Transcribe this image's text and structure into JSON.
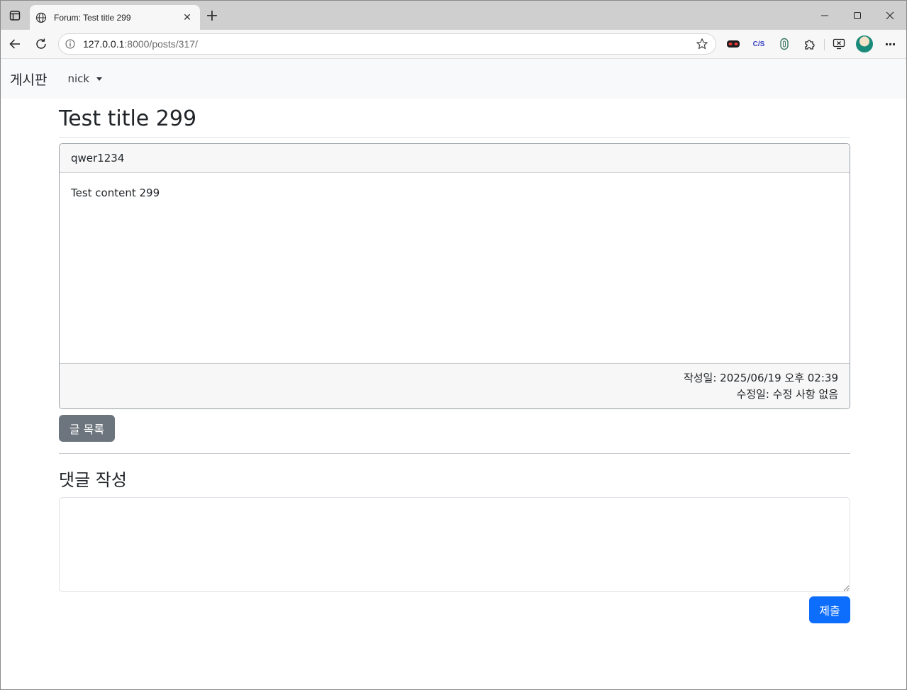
{
  "browser": {
    "tab_title": "Forum: Test title 299",
    "tab_close_glyph": "✕",
    "new_tab_glyph": "+",
    "url_host": "127.0.0.1",
    "url_path": ":8000/posts/317/",
    "icons": [
      "tab-actions-icon",
      "globe-icon",
      "close-icon",
      "plus-icon",
      "back-arrow-icon",
      "reload-icon",
      "info-icon",
      "star-icon",
      "mask-extension-icon",
      "cjs-extension-icon",
      "shield-extension-icon",
      "puzzle-icon",
      "screen-cast-icon",
      "profile-avatar",
      "more-icon",
      "minimize-icon",
      "maximize-icon",
      "close-window-icon"
    ],
    "cjs_label": "C/S",
    "more_glyph": "···"
  },
  "navbar": {
    "brand": "게시판",
    "user": "nick"
  },
  "post": {
    "title": "Test title 299",
    "author": "qwer1234",
    "content": "Test content 299",
    "created": "작성일: 2025/06/19 오후 02:39",
    "modified": "수정일: 수정 사항 없음"
  },
  "actions": {
    "list_label": "글 목록"
  },
  "comment": {
    "heading": "댓글 작성",
    "textarea_value": "",
    "submit_label": "제출"
  },
  "colors": {
    "primary": "#0d6efd",
    "secondary": "#6c757d",
    "navbar_bg": "#f8f9fa"
  }
}
